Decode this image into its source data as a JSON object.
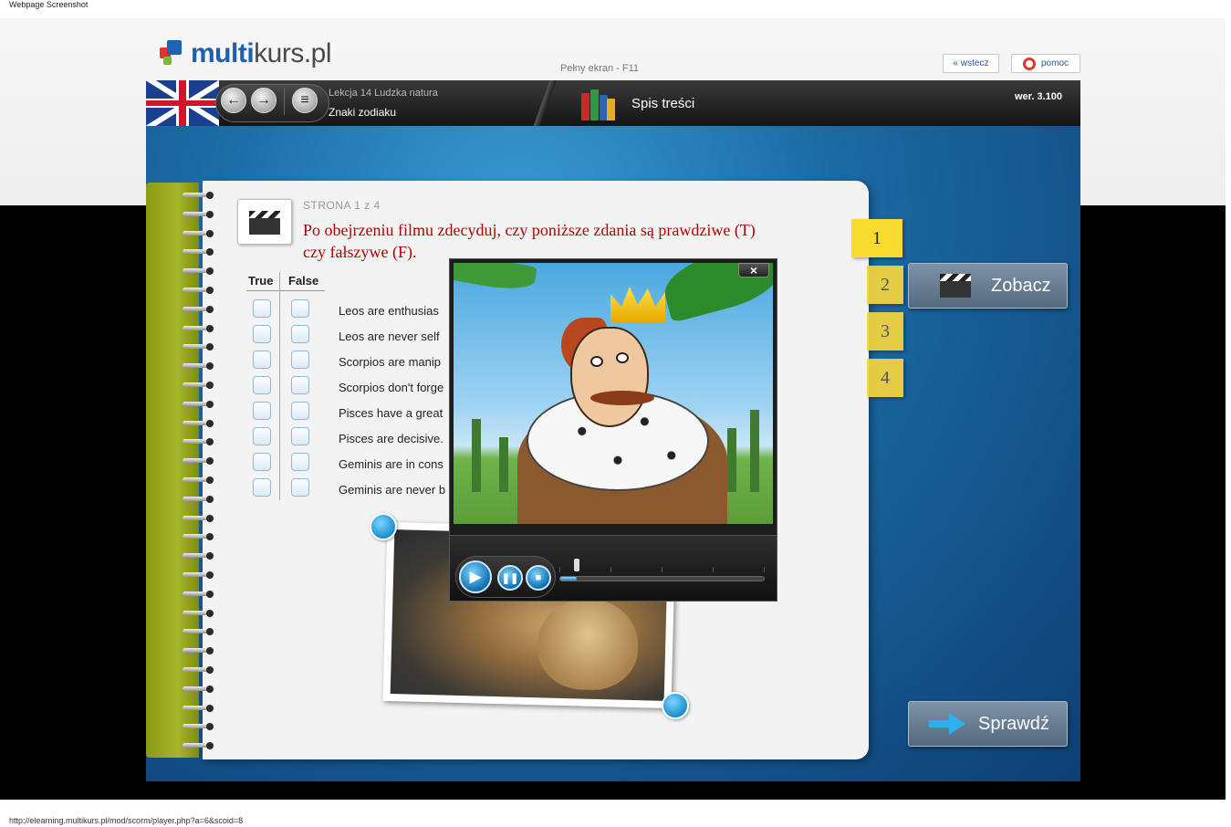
{
  "screenshot_caption": "Webpage Screenshot",
  "status_url": "http://elearning.multikurs.pl/mod/scorm/player.php?a=6&scoid=8",
  "site": {
    "logo_multi": "multi",
    "logo_kurs": "kurs.pl",
    "fullscreen_hint": "Pełny ekran - F11",
    "back_button": "« wstecz",
    "help_button": "pomoc"
  },
  "player": {
    "lesson_title": "Lekcja 14 Ludzka natura",
    "lesson_subtitle": "Znaki zodiaku",
    "toc_label": "Spis treści",
    "version": "wer. 3.100",
    "prev_icon": "arrow-left-icon",
    "next_icon": "arrow-right-icon",
    "menu_icon": "list-icon"
  },
  "exercise": {
    "page_counter": "STRONA 1 z 4",
    "instruction": "Po obejrzeniu filmu zdecyduj, czy poniższe zdania są prawdziwe (T) czy fałszywe (F).",
    "col_true": "True",
    "col_false": "False",
    "sentences": [
      "Leos are enthusias",
      "Leos are never self",
      "Scorpios are manip",
      "Scorpios don't forge",
      "Pisces have a great",
      "Pisces are decisive.",
      "Geminis are in cons",
      "Geminis are never b"
    ]
  },
  "tabs": [
    "1",
    "2",
    "3",
    "4"
  ],
  "active_tab": "1",
  "buttons": {
    "watch": "Zobacz",
    "check": "Sprawdź"
  },
  "video": {
    "close_label": "×",
    "play_symbol": "▶",
    "pause_symbol": "❚❚",
    "stop_symbol": "■",
    "progress": 0.08
  },
  "colors": {
    "instruction": "#b30000",
    "tab": "#f7dc2f",
    "accent": "#1a8fd0"
  }
}
